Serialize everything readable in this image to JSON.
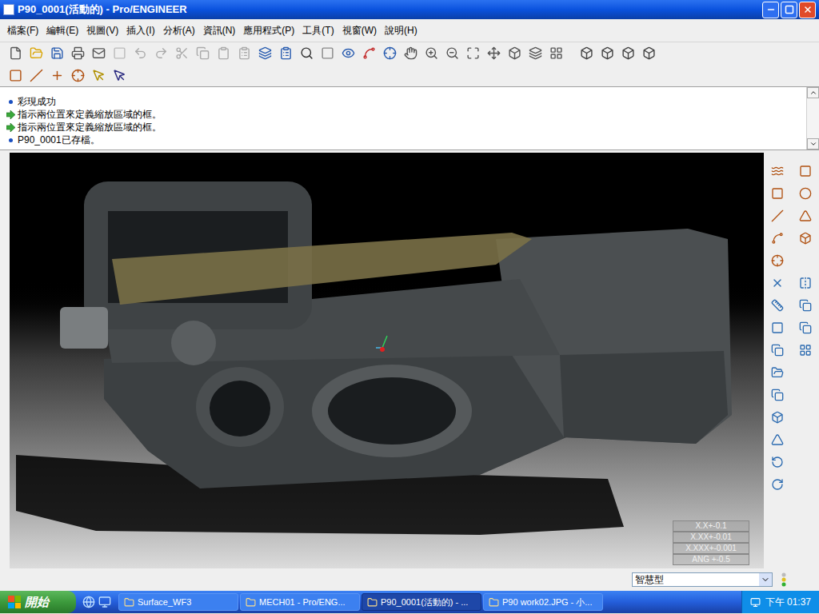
{
  "window": {
    "title": "P90_0001(活動的) - Pro/ENGINEER"
  },
  "menu": [
    "檔案(F)",
    "編輯(E)",
    "視圖(V)",
    "插入(I)",
    "分析(A)",
    "資訊(N)",
    "應用程式(P)",
    "工具(T)",
    "視窗(W)",
    "說明(H)"
  ],
  "messages": [
    {
      "kind": "info",
      "text": "彩現成功"
    },
    {
      "kind": "prompt",
      "text": "指示兩位置來定義縮放區域的框。"
    },
    {
      "kind": "prompt",
      "text": "指示兩位置來定義縮放區域的框。"
    },
    {
      "kind": "info",
      "text": "P90_0001已存檔。"
    }
  ],
  "tolerances": [
    "X.X+-0.1",
    "X.XX+-0.01",
    "X.XXX+-0.001",
    "ANG +-0.5"
  ],
  "status_bar": {
    "filter": "智慧型"
  },
  "taskbar": {
    "start": "開始",
    "items": [
      {
        "label": "Surface_WF3",
        "selected": false
      },
      {
        "label": "MECH01 - Pro/ENG...",
        "selected": false
      },
      {
        "label": "P90_0001(活動的) - ...",
        "selected": true
      },
      {
        "label": "P90 work02.JPG - 小...",
        "selected": false
      }
    ],
    "time": "下午 01:37"
  }
}
